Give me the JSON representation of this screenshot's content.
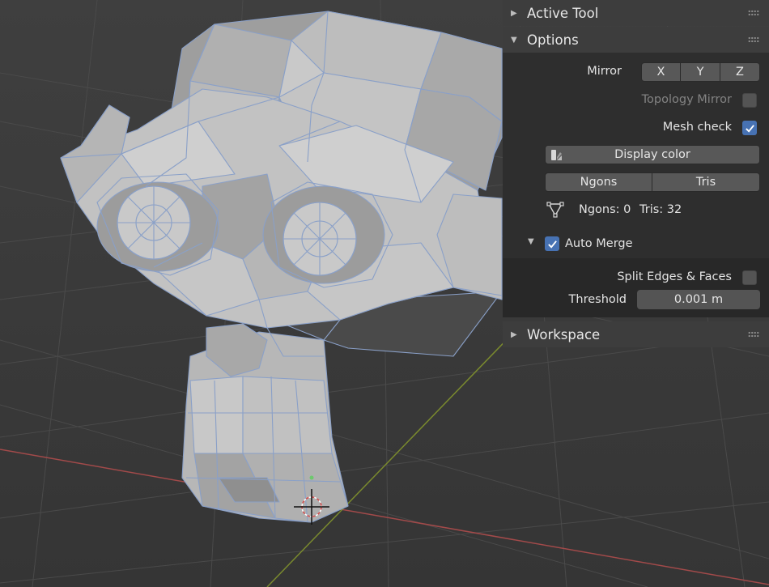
{
  "panels": {
    "active_tool": {
      "title": "Active Tool"
    },
    "options": {
      "title": "Options",
      "mirror": {
        "label": "Mirror",
        "x": "X",
        "y": "Y",
        "z": "Z"
      },
      "topology_mirror": {
        "label": "Topology Mirror",
        "checked": false
      },
      "mesh_check": {
        "label": "Mesh check",
        "checked": true
      },
      "display_color": {
        "label": "Display color"
      },
      "ngons_button": "Ngons",
      "tris_button": "Tris",
      "stats": {
        "ngons": "Ngons: 0",
        "tris": "Tris: 32"
      },
      "auto_merge": {
        "label": "Auto Merge",
        "checked": true
      },
      "split_edges": {
        "label": "Split Edges & Faces",
        "checked": false
      },
      "threshold": {
        "label": "Threshold",
        "value": "0.001 m"
      }
    },
    "workspace": {
      "title": "Workspace"
    }
  },
  "icons": {
    "collapsed": "triangle-right-icon",
    "expanded": "triangle-down-icon",
    "grip": "drag-grip-icon",
    "display_color": "display-color-icon",
    "mesh": "vertex-triangle-icon",
    "checkmark": "checkmark-icon"
  },
  "colors": {
    "accent": "#4772b3",
    "panel_header": "#3d3d3d",
    "panel_body": "#2e2e2e",
    "viewport_bg": "#3c3c3c",
    "mesh_fill": "#b5b5b5",
    "wire": "#8aa0c8",
    "x_axis": "#a24a4a",
    "y_axis": "#7a8a2e"
  }
}
